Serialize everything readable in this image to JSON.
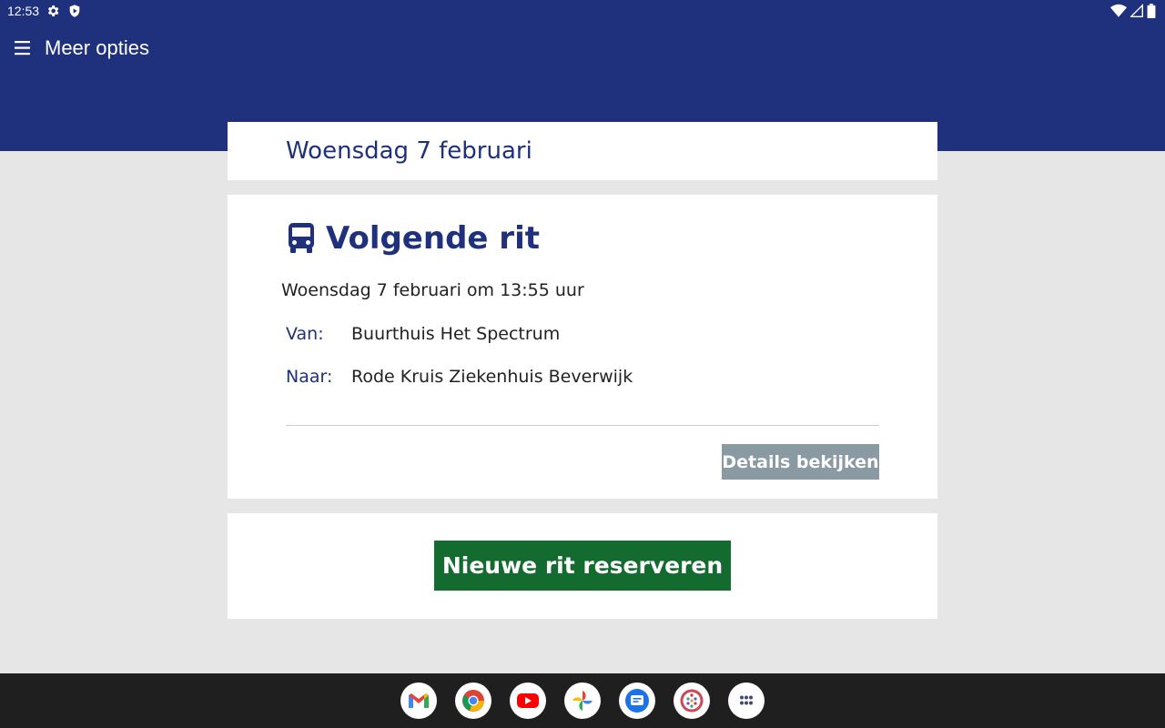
{
  "status_bar": {
    "time": "12:53",
    "left_icons": [
      "settings-icon",
      "shield-icon"
    ],
    "right_icons": [
      "wifi-icon",
      "signal-icon",
      "battery-icon"
    ]
  },
  "app_bar": {
    "menu_icon": "hamburger-menu-icon",
    "title": "Meer opties",
    "background": "#1f307c"
  },
  "date_card": {
    "title": "Woensdag 7 februari"
  },
  "ride_card": {
    "icon": "bus-icon",
    "title": "Volgende rit",
    "datetime": "Woensdag 7 februari om 13:55 uur",
    "from_label": "Van:",
    "from_value": "Buurthuis Het Spectrum",
    "to_label": "Naar:",
    "to_value": "Rode Kruis Ziekenhuis Beverwijk",
    "details_button": "Details bekijken"
  },
  "new_ride_card": {
    "button": "Nieuwe rit reserveren",
    "button_color": "#146b2f"
  },
  "dock": {
    "apps": [
      "gmail-icon",
      "chrome-icon",
      "youtube-icon",
      "photos-icon",
      "messages-icon",
      "app-icon",
      "app-drawer-icon"
    ]
  }
}
